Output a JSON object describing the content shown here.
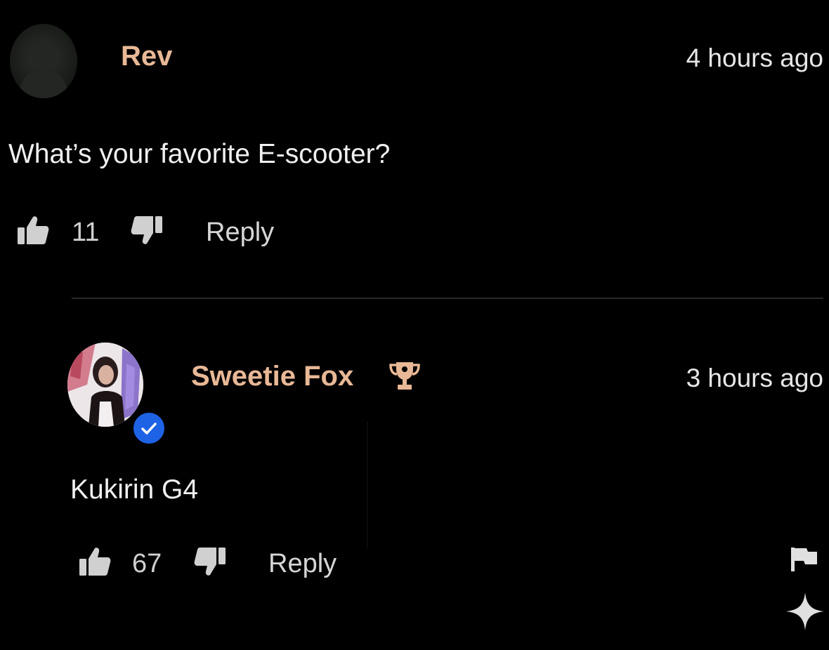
{
  "comments": [
    {
      "username": "Rev",
      "timestamp": "4 hours ago",
      "text": "What’s your favorite E-scooter?",
      "likes": "11",
      "reply_label": "Reply"
    },
    {
      "username": "Sweetie Fox",
      "timestamp": "3 hours ago",
      "text": "Kukirin G4",
      "likes": "67",
      "reply_label": "Reply",
      "verified": true,
      "badge_icon": "trophy-icon"
    }
  ],
  "icons": {
    "like": "thumbs-up-icon",
    "dislike": "thumbs-down-icon",
    "report": "flag-icon",
    "ai": "sparkle-icon"
  },
  "colors": {
    "background": "#000000",
    "username": "#e8b896",
    "verified": "#1e62e6"
  }
}
